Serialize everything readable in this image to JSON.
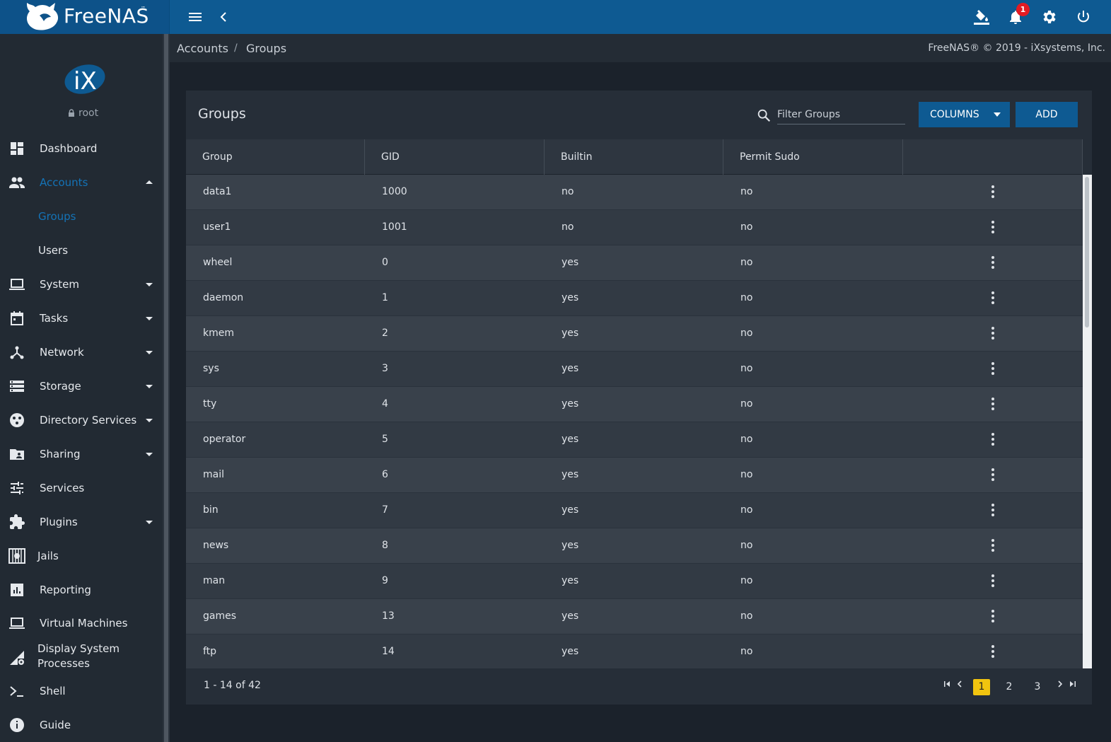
{
  "app": {
    "brand": "FreeNAS",
    "brand_tm": "™",
    "copyright": "FreeNAS® © 2019 - iXsystems, Inc.",
    "notification_count": "1",
    "colors": {
      "topbar": "#0e5a92",
      "accent": "#1473b7",
      "badge": "#e31b23",
      "page_current": "#f1c40f"
    }
  },
  "topbar": {
    "icons": [
      "menu-icon",
      "chevron-left-icon",
      "theme-paint-icon",
      "bell-icon",
      "gear-icon",
      "power-icon"
    ]
  },
  "user": {
    "name": "root"
  },
  "sidebar": {
    "items": [
      {
        "label": "Dashboard",
        "icon": "dashboard-icon"
      },
      {
        "label": "Accounts",
        "icon": "people-icon",
        "expanded": true
      },
      {
        "label": "Groups",
        "sub": true,
        "active": true
      },
      {
        "label": "Users",
        "sub": true
      },
      {
        "label": "System",
        "icon": "laptop-icon"
      },
      {
        "label": "Tasks",
        "icon": "calendar-icon"
      },
      {
        "label": "Network",
        "icon": "network-icon"
      },
      {
        "label": "Storage",
        "icon": "storage-icon"
      },
      {
        "label": "Directory Services",
        "icon": "directory-icon"
      },
      {
        "label": "Sharing",
        "icon": "folder-share-icon"
      },
      {
        "label": "Services",
        "icon": "tune-icon"
      },
      {
        "label": "Plugins",
        "icon": "puzzle-icon"
      },
      {
        "label": "Jails",
        "icon": "jail-icon"
      },
      {
        "label": "Reporting",
        "icon": "chart-icon"
      },
      {
        "label": "Virtual Machines",
        "icon": "laptop-icon"
      },
      {
        "label": "Display System Processes",
        "icon": "processes-icon"
      },
      {
        "label": "Shell",
        "icon": "terminal-icon"
      },
      {
        "label": "Guide",
        "icon": "info-icon"
      }
    ]
  },
  "breadcrumb": {
    "parent": "Accounts",
    "separator": "/",
    "current": "Groups"
  },
  "card": {
    "title": "Groups",
    "filter_placeholder": "Filter Groups",
    "columns_button": "COLUMNS",
    "add_button": "ADD"
  },
  "table": {
    "headers": [
      "Group",
      "GID",
      "Builtin",
      "Permit Sudo"
    ],
    "rows": [
      [
        "data1",
        "1000",
        "no",
        "no"
      ],
      [
        "user1",
        "1001",
        "no",
        "no"
      ],
      [
        "wheel",
        "0",
        "yes",
        "no"
      ],
      [
        "daemon",
        "1",
        "yes",
        "no"
      ],
      [
        "kmem",
        "2",
        "yes",
        "no"
      ],
      [
        "sys",
        "3",
        "yes",
        "no"
      ],
      [
        "tty",
        "4",
        "yes",
        "no"
      ],
      [
        "operator",
        "5",
        "yes",
        "no"
      ],
      [
        "mail",
        "6",
        "yes",
        "no"
      ],
      [
        "bin",
        "7",
        "yes",
        "no"
      ],
      [
        "news",
        "8",
        "yes",
        "no"
      ],
      [
        "man",
        "9",
        "yes",
        "no"
      ],
      [
        "games",
        "13",
        "yes",
        "no"
      ],
      [
        "ftp",
        "14",
        "yes",
        "no"
      ]
    ]
  },
  "pagination": {
    "range": "1 - 14 of 42",
    "pages": [
      "1",
      "2",
      "3"
    ],
    "current": "1"
  }
}
